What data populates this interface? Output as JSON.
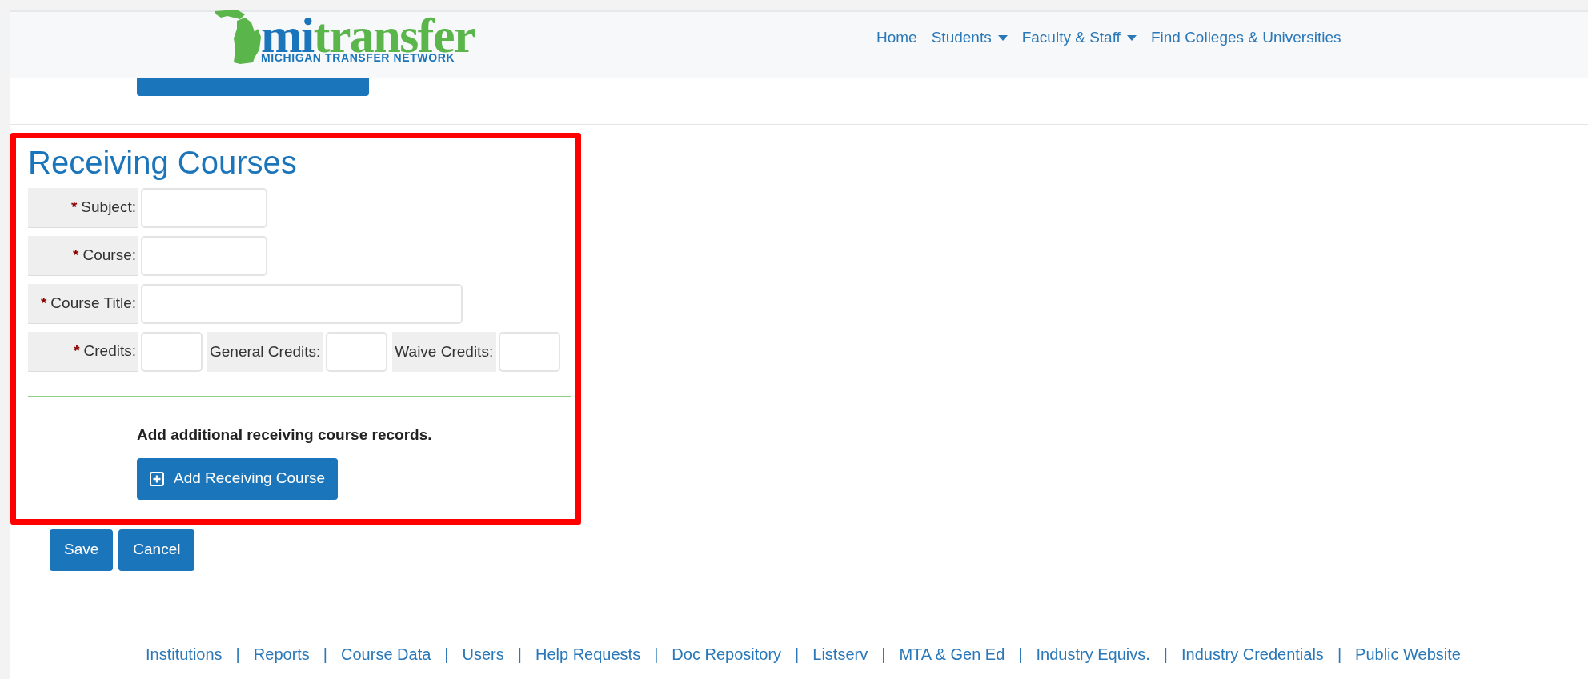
{
  "header": {
    "logo": {
      "wordmark_first": "mi",
      "wordmark_second": "transfer",
      "tagline": "MICHIGAN TRANSFER NETWORK"
    },
    "nav": [
      {
        "label": "Home",
        "dropdown": false
      },
      {
        "label": "Students",
        "dropdown": true
      },
      {
        "label": "Faculty & Staff",
        "dropdown": true
      },
      {
        "label": "Find Colleges & Universities",
        "dropdown": false
      }
    ]
  },
  "receiving_courses": {
    "title": "Receiving Courses",
    "rows": [
      {
        "fields": [
          {
            "label": "Subject:",
            "required_mark": "*",
            "kind": "medium"
          }
        ]
      },
      {
        "fields": [
          {
            "label": "Course:",
            "required_mark": "*",
            "kind": "medium"
          }
        ]
      },
      {
        "fields": [
          {
            "label": "Course Title:",
            "required_mark": "*",
            "kind": "wide"
          }
        ]
      },
      {
        "fields": [
          {
            "label": "Credits:",
            "required_mark": "*",
            "kind": "small"
          },
          {
            "label": "General Credits:",
            "kind": "small"
          },
          {
            "label": "Waive Credits:",
            "kind": "small"
          }
        ]
      }
    ],
    "note": "Add additional receiving course records.",
    "add_button": "Add Receiving Course"
  },
  "actions": [
    "Save",
    "Cancel"
  ],
  "footer_links": [
    "Institutions",
    "Reports",
    "Course Data",
    "Users",
    "Help Requests",
    "Doc Repository",
    "Listserv",
    "MTA & Gen Ed",
    "Industry Equivs.",
    "Industry Credentials",
    "Public Website"
  ],
  "footer_separator": "|"
}
